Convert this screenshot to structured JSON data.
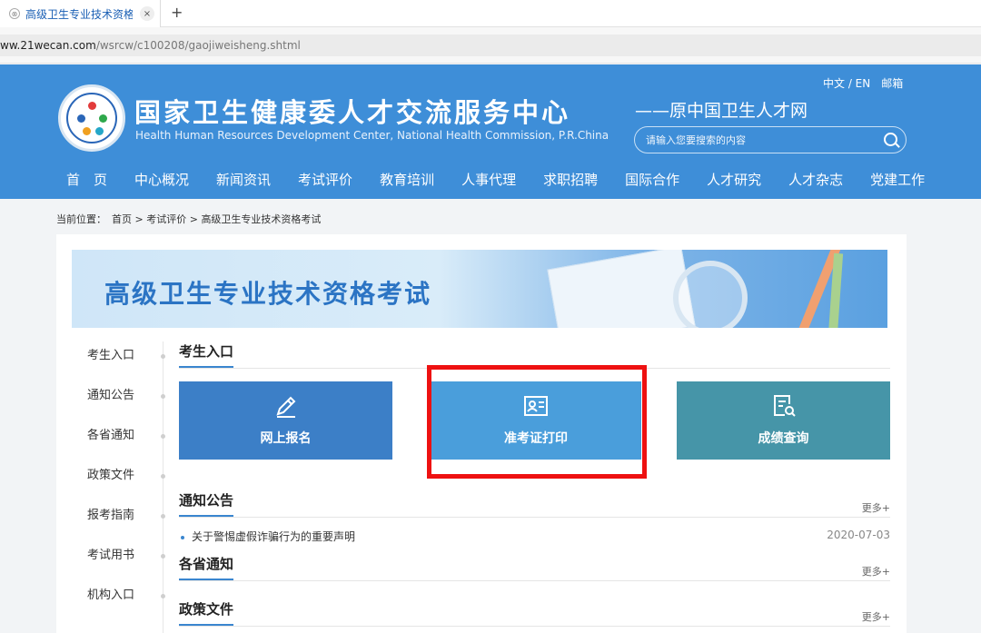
{
  "browser": {
    "tab_title": "高级卫生专业技术资格考",
    "new_tab": "+",
    "close": "×",
    "url_host": "ww.21wecan.com",
    "url_path": "/wsrcw/c100208/gaojiweisheng.shtml"
  },
  "header": {
    "title": "国家卫生健康委人才交流服务中心",
    "subtitle": "Health Human Resources Development Center, National Health Commission, P.R.China",
    "alias": "——原中国卫生人才网",
    "lang": "中文 / EN",
    "mail": "邮箱",
    "search_placeholder": "请输入您要搜索的内容"
  },
  "nav": [
    "首　页",
    "中心概况",
    "新闻资讯",
    "考试评价",
    "教育培训",
    "人事代理",
    "求职招聘",
    "国际合作",
    "人才研究",
    "人才杂志",
    "党建工作"
  ],
  "breadcrumb": {
    "label": "当前位置：",
    "home": "首页",
    "sep1": " > ",
    "level1": "考试评价",
    "sep2": " > ",
    "current": "高级卫生专业技术资格考试"
  },
  "banner_title": "高级卫生专业技术资格考试",
  "sidebar": [
    "考生入口",
    "通知公告",
    "各省通知",
    "政策文件",
    "报考指南",
    "考试用书",
    "机构入口"
  ],
  "sections": {
    "entry": {
      "title": "考生入口"
    },
    "notice": {
      "title": "通知公告",
      "more": "更多+"
    },
    "province": {
      "title": "各省通知",
      "more": "更多+"
    },
    "policy": {
      "title": "政策文件",
      "more": "更多+"
    }
  },
  "cards": [
    {
      "label": "网上报名",
      "icon": "pencil-icon",
      "color": "#3c7fc7"
    },
    {
      "label": "准考证打印",
      "icon": "id-card-icon",
      "color": "#4a9edb"
    },
    {
      "label": "成绩查询",
      "icon": "document-search-icon",
      "color": "#4695a8"
    }
  ],
  "notices": [
    {
      "title": "关于警惕虚假诈骗行为的重要声明",
      "date": "2020-07-03"
    }
  ],
  "highlight_color": "#ee1111"
}
